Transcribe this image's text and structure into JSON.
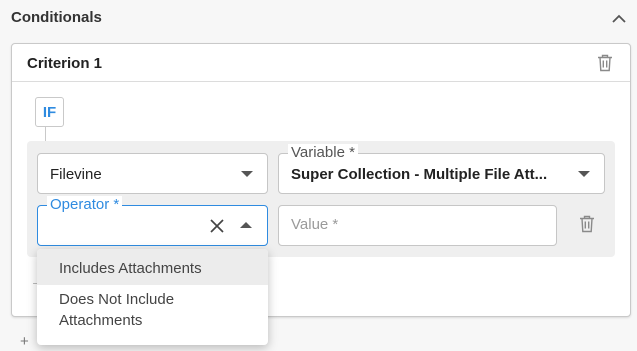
{
  "section": {
    "title": "Conditionals"
  },
  "criterion": {
    "title": "Criterion 1",
    "badge": "IF"
  },
  "fields": {
    "source": {
      "value": "Filevine"
    },
    "variable": {
      "label": "Variable *",
      "value": "Super Collection - Multiple File Att..."
    },
    "operator": {
      "label": "Operator *"
    },
    "value": {
      "placeholder": "Value *"
    }
  },
  "operator_options": [
    "Includes Attachments",
    "Does Not Include Attachments"
  ],
  "footer": {
    "add_icon": "+"
  },
  "colors": {
    "accent": "#2f8be0",
    "border": "#c6c6c6",
    "highlight": "#ececec"
  },
  "icons": [
    "chevron-up-icon",
    "trash-icon",
    "chevron-down-icon",
    "close-icon",
    "plus-icon"
  ]
}
